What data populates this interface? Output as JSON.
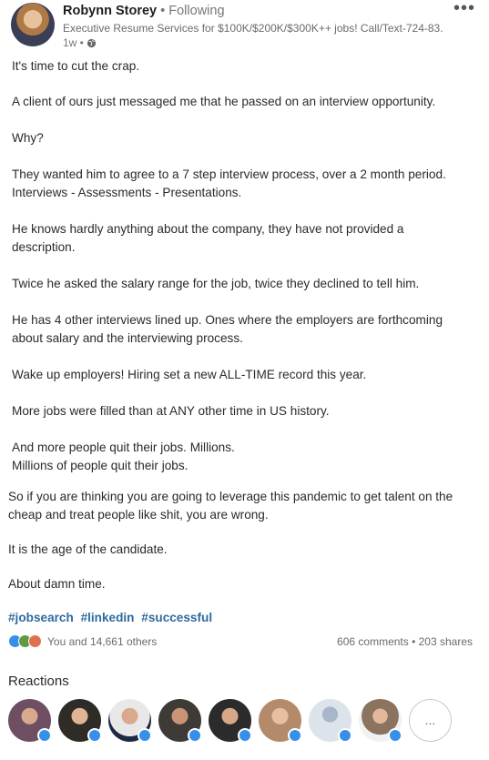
{
  "author": {
    "name": "Robynn Storey",
    "separator": "•",
    "follow_status": "Following",
    "headline": "Executive Resume Services for $100K/$200K/$300K++ jobs! Call/Text-724-83...",
    "time": "1w •"
  },
  "post": {
    "lines": [
      "It's time to cut the crap.",
      "A client of ours just messaged me that he passed on an interview opportunity.",
      "Why?",
      "They wanted him to agree to a 7 step interview process, over a 2 month period.",
      "Interviews - Assessments - Presentations.",
      "He knows hardly anything about the company, they have not provided a",
      "description.",
      "Twice he asked the salary range for the job, twice they declined to tell him.",
      "He has 4 other interviews lined up. Ones where the employers are forthcoming",
      "about salary and the interviewing process.",
      "Wake up employers! Hiring set a new ALL-TIME record this year.",
      "More jobs were filled than at ANY other time in US history.",
      "And more people quit their jobs. Millions.",
      "Millions of people quit their jobs.",
      "So if you are thinking you are going to leverage this pandemic to get talent on the",
      "cheap and treat people like shit, you are wrong.",
      "It is the age of the candidate.",
      "About damn time."
    ],
    "hashtags": [
      "#jobsearch",
      "#linkedin",
      "#successful"
    ]
  },
  "social": {
    "reactions_text": "You and 14,661 others",
    "comments_shares": "606 comments • 203 shares"
  },
  "reactions_section": {
    "title": "Reactions",
    "more_label": "..."
  },
  "colors": {
    "link": "#2f6a9e",
    "like_badge": "#378fe9"
  }
}
